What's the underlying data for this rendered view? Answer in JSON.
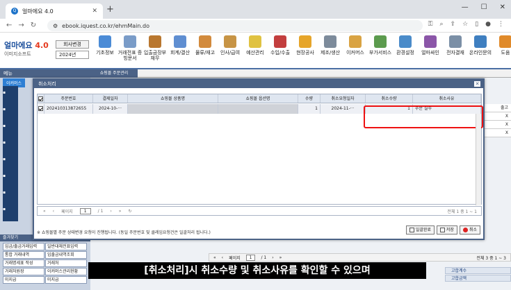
{
  "browser": {
    "tab_title": "얼마에요 4.0",
    "new_tab": "+",
    "url": "ebook.iquest.co.kr/ehmMain.do",
    "win_min": "—",
    "win_max": "☐",
    "win_close": "✕"
  },
  "app": {
    "logo": "얼마에요",
    "logo_version": "4.0",
    "logo_sub": "이미지소프트",
    "company_button": "회사변경",
    "year": "2024년",
    "menus": [
      {
        "label": "기초정보",
        "color": "#4b8bd6"
      },
      {
        "label": "거래전표 증빙문서",
        "color": "#7a9cc8"
      },
      {
        "label": "입출금장부 재무",
        "color": "#b9772f"
      },
      {
        "label": "회계/결산",
        "color": "#5f8ed1"
      },
      {
        "label": "물류/재고",
        "color": "#d28a3c"
      },
      {
        "label": "인사/급여",
        "color": "#c79445"
      },
      {
        "label": "예산관리",
        "color": "#e0c241"
      },
      {
        "label": "수입/수출",
        "color": "#c33e3e"
      },
      {
        "label": "현장공사",
        "color": "#e6a52a"
      },
      {
        "label": "제조/생산",
        "color": "#7d8b9b"
      },
      {
        "label": "이커머스",
        "color": "#d9a343"
      },
      {
        "label": "부가서비스",
        "color": "#5c9b4e"
      },
      {
        "label": "환경설정",
        "color": "#4a8bc9"
      },
      {
        "label": "얼마싸인",
        "color": "#8b56a8"
      },
      {
        "label": "전자결재",
        "color": "#7b8fa6"
      },
      {
        "label": "온라인문의",
        "color": "#3f7fc0"
      },
      {
        "label": "도움",
        "color": "#e08a2a"
      }
    ]
  },
  "left": {
    "header": "메뉴",
    "tab1": "이커머스",
    "tab2": "즐겨찾기",
    "favorites_header": "즐겨찾기",
    "favorites": [
      "입금/출금거래입력",
      "일반대체전표입력",
      "통합 거래내역",
      "입출금내역조회",
      "거래명세표 작성",
      "거래처",
      "거래처원장",
      "이커머스관리현황",
      "미지급",
      "미지급"
    ]
  },
  "main": {
    "tab": "쇼핑몰 주문관리",
    "bottom_page_label": "페이지",
    "bottom_page": "1",
    "bottom_total_pages": "/ 1",
    "bottom_count": "전체 3 중 1 ~ 3",
    "right_col": [
      "출고",
      "X",
      "X",
      "X"
    ],
    "bottom_right": [
      "고합계수",
      "고합금액"
    ]
  },
  "dialog": {
    "title": "취소처리",
    "columns": [
      "",
      "주문번호",
      "결제일자",
      "쇼핑몰 상품명",
      "쇼핑몰 옵션명",
      "수량",
      "취소요청일자",
      "취소수량",
      "취소사유"
    ],
    "row": {
      "order_no": "202410313872655",
      "pay_date": "2024-10-···",
      "product": "",
      "option": "",
      "qty": "1",
      "cancel_req_date": "2024-11-···",
      "cancel_qty": "1",
      "cancel_reason": "주문 실수"
    },
    "pager": {
      "label": "페이지",
      "page": "1",
      "of": "/ 1",
      "total": "전체 1 중 1 ~ 1"
    },
    "footnote": "※ 쇼핑몰별 주문 상태변경 요청이 진행됩니다. (동일 주문번호 및 클레임요청건은 일괄처리 됩니다.)",
    "buttons": {
      "partial": "일괄완료",
      "save": "저장",
      "cancel": "취소"
    }
  },
  "subtitle": "[취소처리]시 취소수량 및 취소사유를 확인할 수 있으며"
}
